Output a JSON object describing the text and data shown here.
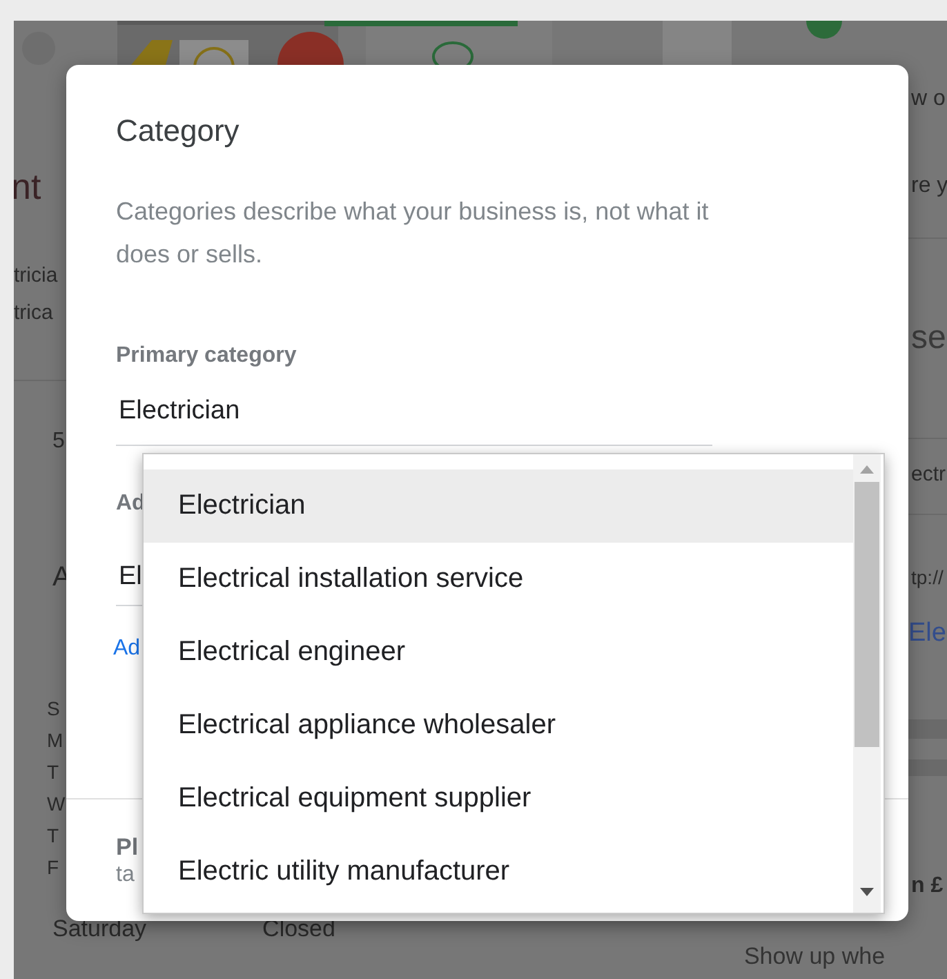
{
  "background": {
    "left_fragments": {
      "heading": "nt",
      "lines": [
        "tricia",
        "trica"
      ],
      "count": "5",
      "label": "A",
      "days": [
        "S",
        "M",
        "T",
        "W",
        "T",
        "F"
      ]
    },
    "right_fragments": {
      "lines": [
        "w o",
        "re y"
      ],
      "heading": "se",
      "value": "ectr",
      "url": "tp://",
      "link": "Ele",
      "price": "n £"
    },
    "hours_row": {
      "day": "Saturday",
      "status": "Closed"
    },
    "promo": "Show up whe"
  },
  "dialog": {
    "title": "Category",
    "description": "Categories describe what your business is, not what it does or sells.",
    "primary": {
      "label": "Primary category",
      "value": "Electrician"
    },
    "additional": {
      "label": "Ad",
      "value": "El",
      "link": "Ad"
    },
    "footer": {
      "title": "Pl",
      "text": "ta"
    }
  },
  "dropdown": {
    "options": [
      {
        "label": "Electrician",
        "selected": true
      },
      {
        "label": "Electrical installation service",
        "selected": false
      },
      {
        "label": "Electrical engineer",
        "selected": false
      },
      {
        "label": "Electrical appliance wholesaler",
        "selected": false
      },
      {
        "label": "Electrical equipment supplier",
        "selected": false
      },
      {
        "label": "Electric utility manufacturer",
        "selected": false
      }
    ]
  }
}
